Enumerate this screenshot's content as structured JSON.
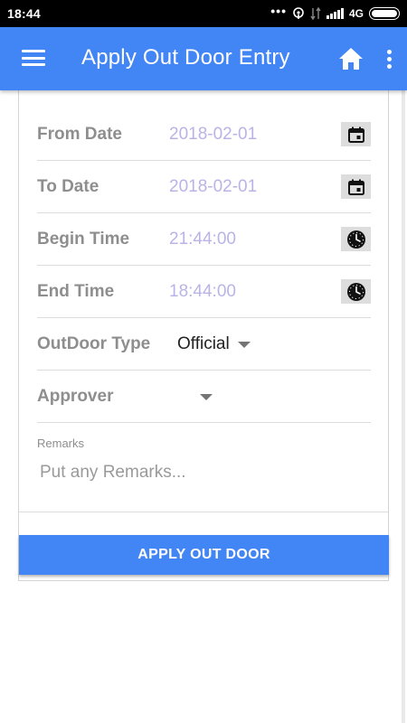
{
  "status_bar": {
    "time": "18:44",
    "network": "4G"
  },
  "app_bar": {
    "title": "Apply Out Door Entry",
    "icons": [
      "menu-icon",
      "home-icon",
      "more-vert-icon"
    ]
  },
  "form": {
    "from_date": {
      "label": "From Date",
      "value": "2018-02-01",
      "picker_icon": "calendar-icon"
    },
    "to_date": {
      "label": "To Date",
      "value": "2018-02-01",
      "picker_icon": "calendar-icon"
    },
    "begin_time": {
      "label": "Begin Time",
      "value": "21:44:00",
      "picker_icon": "clock-icon"
    },
    "end_time": {
      "label": "End Time",
      "value": "18:44:00",
      "picker_icon": "clock-icon"
    },
    "outdoor_type": {
      "label": "OutDoor Type",
      "selected": "Official"
    },
    "approver": {
      "label": "Approver",
      "selected": ""
    },
    "remarks": {
      "label": "Remarks",
      "placeholder": "Put any Remarks...",
      "value": ""
    }
  },
  "actions": {
    "apply_label": "APPLY OUT DOOR"
  },
  "colors": {
    "primary": "#4285f4",
    "label_gray": "#8e8e8e",
    "value_lavender": "#b9b3e6"
  }
}
